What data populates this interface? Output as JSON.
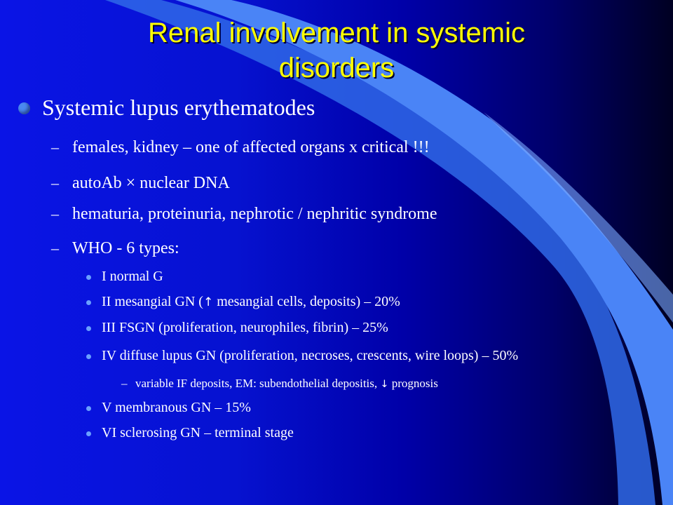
{
  "slide": {
    "title_line1": "Renal involvement in systemic",
    "title_line2": "disorders",
    "bullet": "Systemic lupus erythematodes",
    "sub_items": [
      "females, kidney – one of affected organs x critical !!!",
      "autoAb × nuclear DNA",
      "hematuria, proteinuria, nephrotic / nephritic syndrome",
      "WHO - 6 types:"
    ],
    "types": {
      "t1": "I   normal G",
      "t2_pre": "II   mesangial GN (",
      "t2_post": " mesangial cells, deposits) – 20%",
      "t3": "III  FSGN (proliferation, neurophiles, fibrin) – 25%",
      "t4": "IV  diffuse lupus GN (proliferation, necroses, crescents, wire loops) – 50%",
      "t4_sub_pre": "variable IF deposits, EM: subendothelial depositis, ",
      "t4_sub_post": " prognosis",
      "t5": "V membranous GN – 15%",
      "t6": "VI sclerosing GN – terminal stage"
    },
    "arrows": {
      "up": "↑",
      "down": "↓"
    },
    "dash": "–",
    "colors": {
      "title": "#ffff00",
      "text": "#ffffff",
      "background": "#0000a8",
      "swoosh": "#3f7af5"
    }
  }
}
